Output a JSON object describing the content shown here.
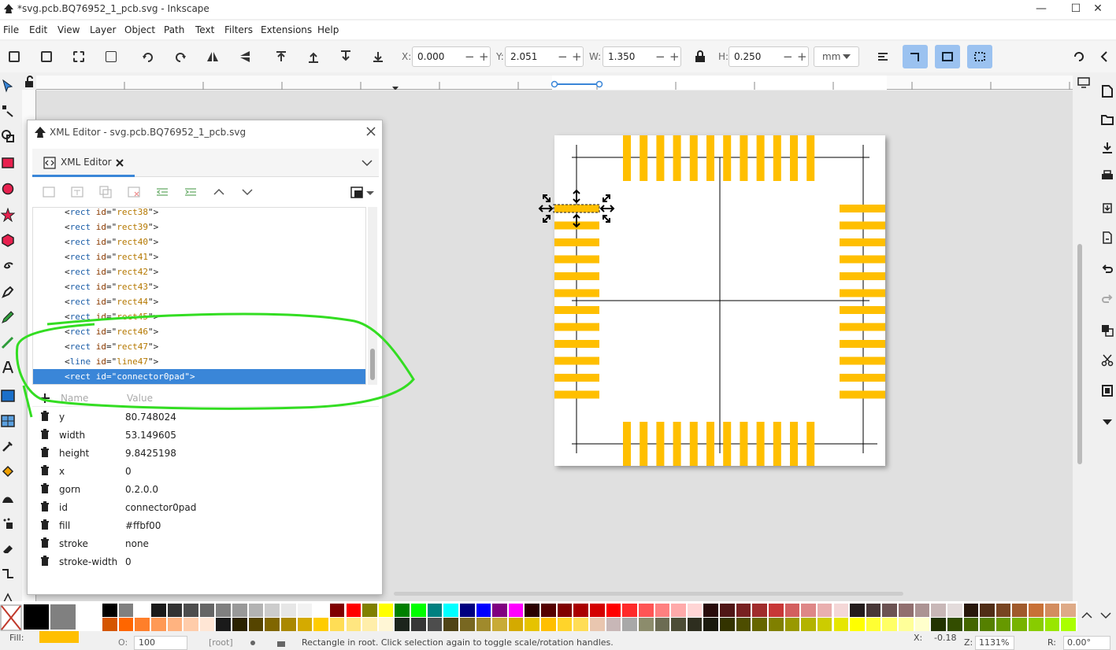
{
  "app": {
    "title": "*svg.pcb.BQ76952_1_pcb.svg - Inkscape"
  },
  "window_controls": {
    "minimize": "—",
    "maximize": "☐",
    "close": "✕"
  },
  "menu": [
    "File",
    "Edit",
    "View",
    "Layer",
    "Object",
    "Path",
    "Text",
    "Filters",
    "Extensions",
    "Help"
  ],
  "toolbar": {
    "x_label": "X:",
    "x_value": "0.000",
    "y_label": "Y:",
    "y_value": "2.051",
    "w_label": "W:",
    "w_value": "1.350",
    "h_label": "H:",
    "h_value": "0.250",
    "unit": "mm",
    "minus": "−",
    "plus": "+"
  },
  "xml_editor": {
    "window_title": "XML Editor - svg.pcb.BQ76952_1_pcb.svg",
    "tab_label": "XML Editor",
    "nodes": [
      {
        "tag": "rect",
        "attr": "id",
        "value": "rect38"
      },
      {
        "tag": "rect",
        "attr": "id",
        "value": "rect39"
      },
      {
        "tag": "rect",
        "attr": "id",
        "value": "rect40"
      },
      {
        "tag": "rect",
        "attr": "id",
        "value": "rect41"
      },
      {
        "tag": "rect",
        "attr": "id",
        "value": "rect42"
      },
      {
        "tag": "rect",
        "attr": "id",
        "value": "rect43"
      },
      {
        "tag": "rect",
        "attr": "id",
        "value": "rect44"
      },
      {
        "tag": "rect",
        "attr": "id",
        "value": "rect45"
      },
      {
        "tag": "rect",
        "attr": "id",
        "value": "rect46"
      },
      {
        "tag": "rect",
        "attr": "id",
        "value": "rect47"
      },
      {
        "tag": "line",
        "attr": "id",
        "value": "line47"
      },
      {
        "tag": "rect",
        "attr": "id",
        "value": "connector0pad"
      }
    ],
    "selected_node_index": 11,
    "attr_header": {
      "name": "Name",
      "value": "Value"
    },
    "attributes": [
      {
        "name": "y",
        "value": "80.748024"
      },
      {
        "name": "width",
        "value": "53.149605"
      },
      {
        "name": "height",
        "value": "9.8425198"
      },
      {
        "name": "x",
        "value": "0"
      },
      {
        "name": "gorn",
        "value": "0.2.0.0"
      },
      {
        "name": "id",
        "value": "connector0pad"
      },
      {
        "name": "fill",
        "value": "#ffbf00"
      },
      {
        "name": "stroke",
        "value": "none"
      },
      {
        "name": "stroke-width",
        "value": "0"
      }
    ]
  },
  "canvas": {
    "pad_color": "#ffbf00",
    "line_color": "#000000",
    "selection_color": "#000000",
    "annotation_color": "#33dd22"
  },
  "palette": {
    "row1": [
      "#000000",
      "#808080",
      "#ffffff",
      "#1a1a1a",
      "#333333",
      "#4d4d4d",
      "#666666",
      "#808080",
      "#999999",
      "#b3b3b3",
      "#cccccc",
      "#e6e6e6",
      "#f2f2f2",
      "#ffffff",
      "#800000",
      "#ff0000",
      "#808000",
      "#ffff00",
      "#008000",
      "#00ff00",
      "#008080",
      "#00ffff",
      "#000080",
      "#0000ff",
      "#800080",
      "#ff00ff",
      "#2b0000",
      "#550000",
      "#800000",
      "#aa0000",
      "#d40000",
      "#ff0000",
      "#ff2a2a",
      "#ff5555",
      "#ff8080",
      "#ffaaaa",
      "#ffd5d5",
      "#280b0b",
      "#501616",
      "#782121",
      "#a02c2c",
      "#c83737",
      "#d35f5f",
      "#de8787",
      "#e9afaf",
      "#f4d7d7",
      "#241c1c",
      "#483737",
      "#6c5353",
      "#916f6f",
      "#ac9393",
      "#c8b7b7",
      "#e3dbdb",
      "#28170b",
      "#502d16",
      "#784421",
      "#a05a2c",
      "#c87137",
      "#d38d5f",
      "#deaa87"
    ],
    "row2": [
      "#d45500",
      "#ff6600",
      "#ff7f2a",
      "#ff9955",
      "#ffb380",
      "#ffccaa",
      "#ffe6d5",
      "#1a1a1a",
      "#2b2200",
      "#554400",
      "#806600",
      "#aa8800",
      "#d4aa00",
      "#ffcc00",
      "#ffdd55",
      "#ffe680",
      "#ffeeaa",
      "#fff6d5",
      "#1c241c",
      "#373737",
      "#4d4d4d",
      "#504416",
      "#786721",
      "#a08a2c",
      "#c8ab37",
      "#d4aa00",
      "#e6c300",
      "#ffbf00",
      "#ffd42a",
      "#ffdd55",
      "#e9c6af",
      "#c8b7b7",
      "#a8a8a8",
      "#8c8c6c",
      "#6c6c53",
      "#4d4d36",
      "#2e2e1f",
      "#1a1a0d",
      "#333300",
      "#4d4d00",
      "#666600",
      "#808000",
      "#999900",
      "#b3b300",
      "#cccc00",
      "#e6e600",
      "#ffff00",
      "#ffff33",
      "#ffff66",
      "#ffff99",
      "#ffffcc",
      "#223300",
      "#334d00",
      "#446600",
      "#558000",
      "#669900",
      "#77b300",
      "#88cc00",
      "#99e600",
      "#aaff00"
    ]
  },
  "status": {
    "fill_label": "Fill:",
    "fill_color": "#ffbf00",
    "opacity_label": "O:",
    "opacity_value": "100",
    "layer": "[root]",
    "message": "Rectangle in root. Click selection again to toggle scale/rotation handles.",
    "x_label": "X:",
    "x_value": "-0.18",
    "zoom_label": "Z:",
    "zoom_value": "1131%",
    "rot_label": "R:",
    "rot_value": "0.00°"
  }
}
